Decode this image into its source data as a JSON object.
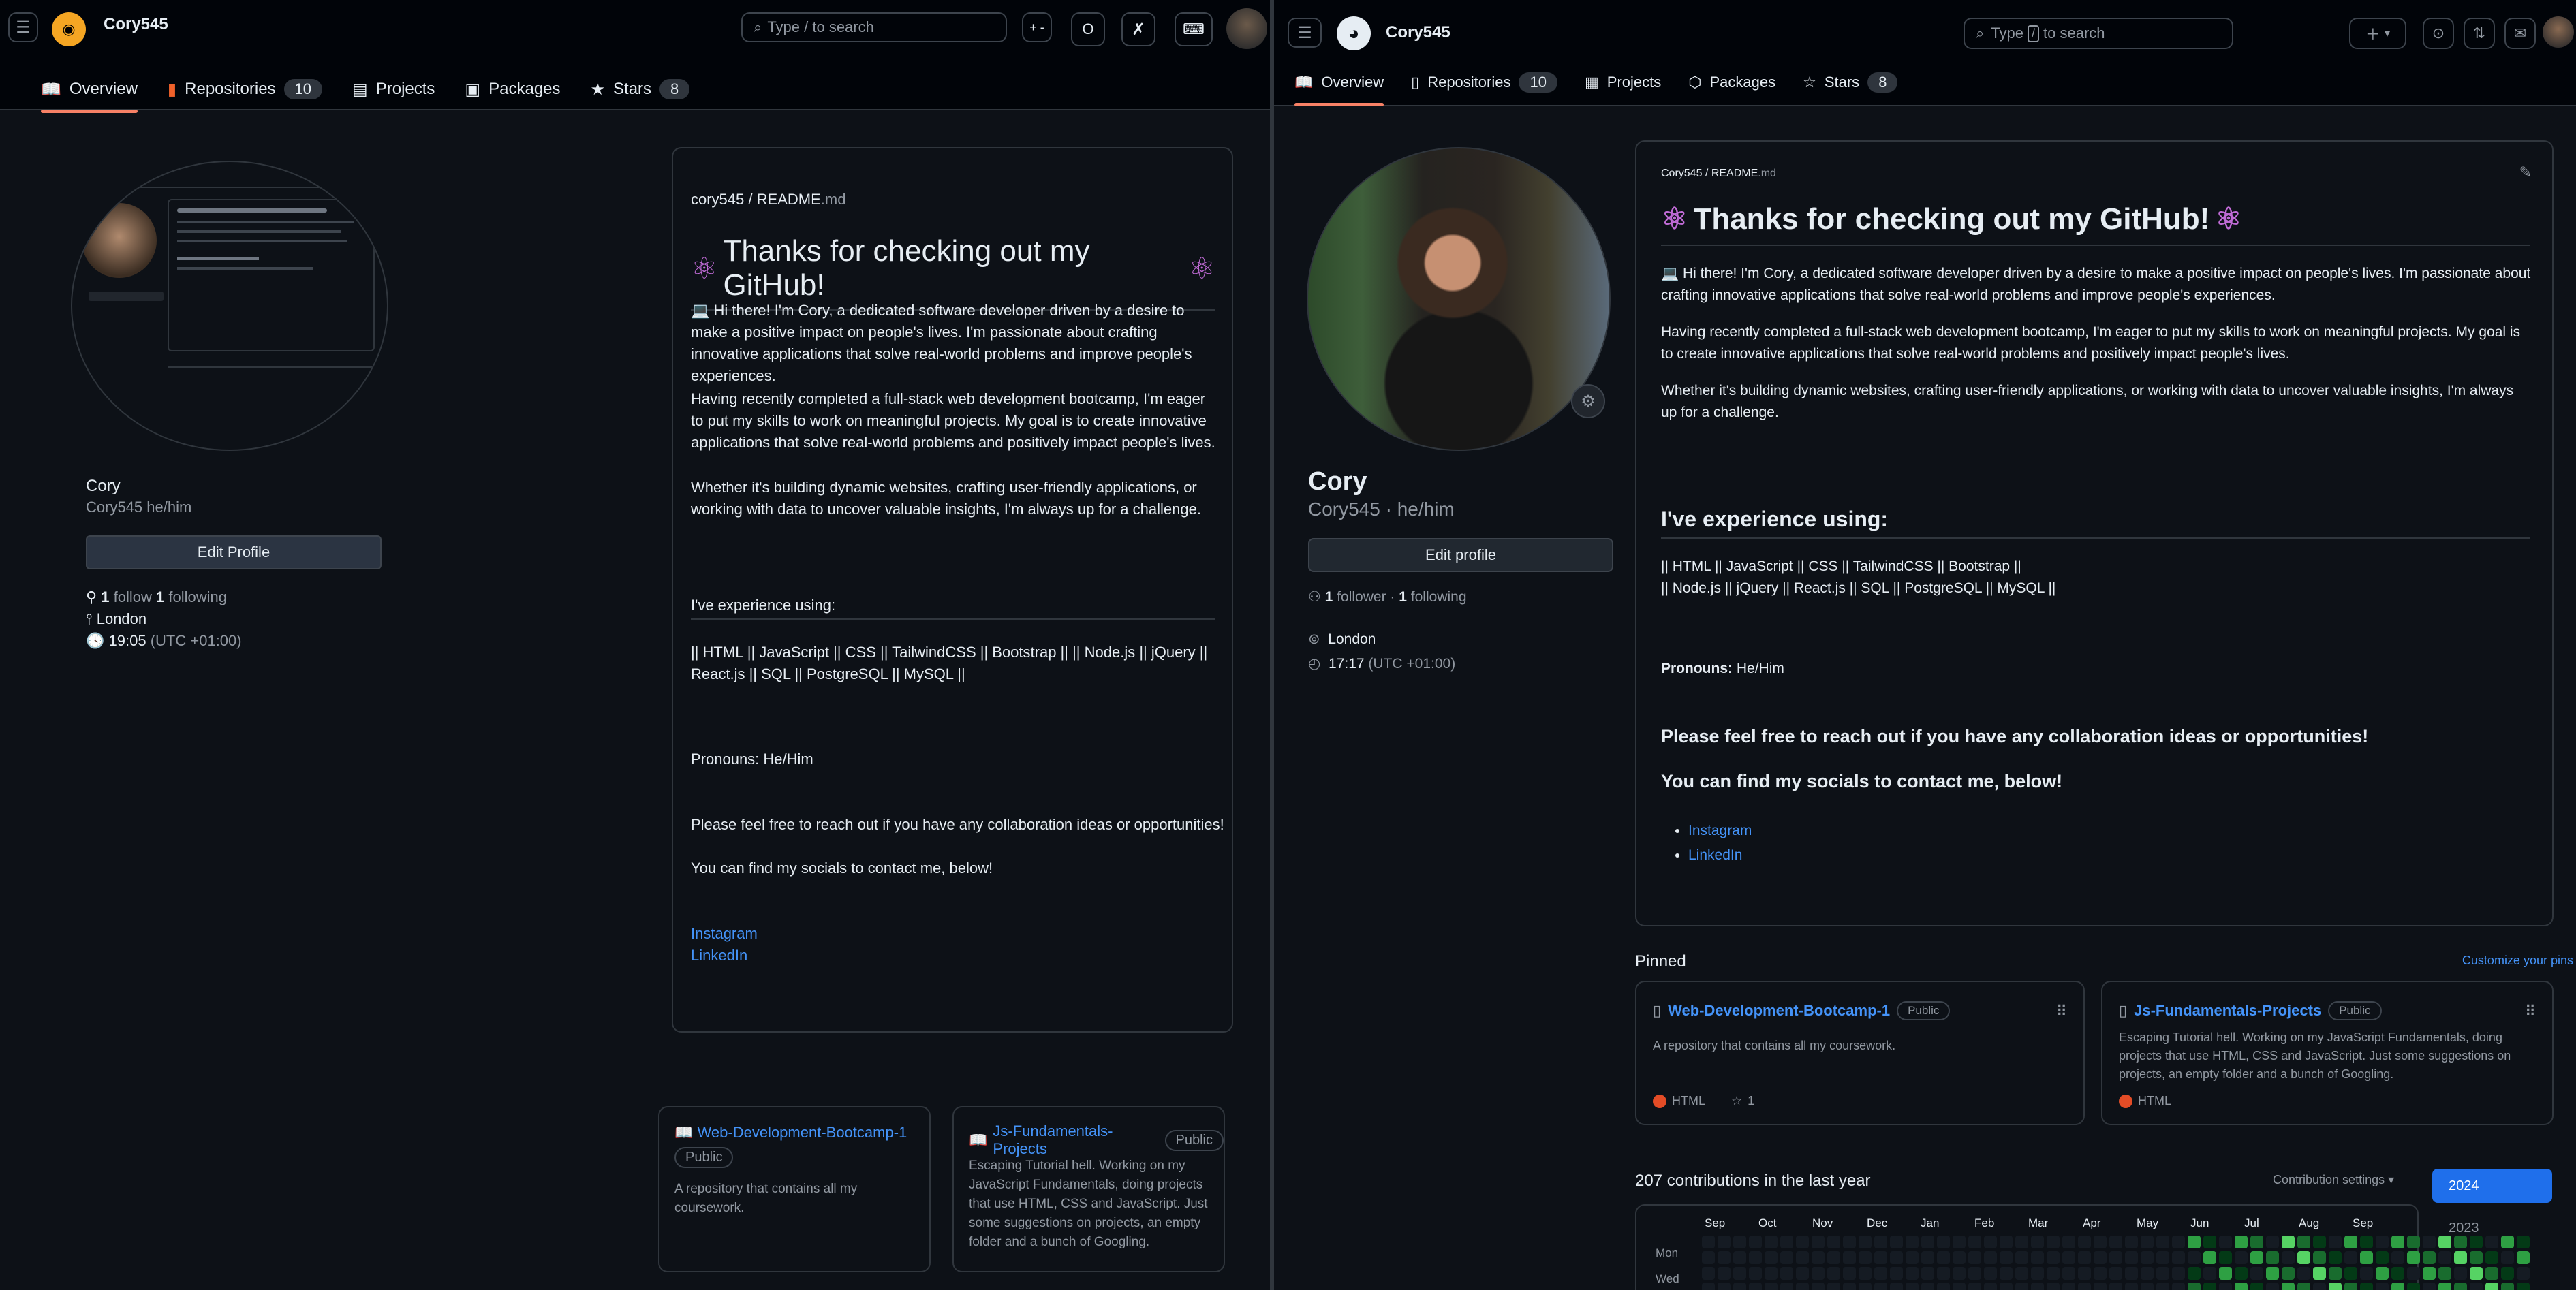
{
  "left": {
    "header": {
      "user": "Cory545",
      "search_placeholder": "Type / to search",
      "plusminus": "+ -",
      "circle_btn": "O",
      "x_btn": "✗",
      "kbd_btn": "⌨"
    },
    "tabs": [
      {
        "label": "Overview"
      },
      {
        "label": "Repositories",
        "count": "10"
      },
      {
        "label": "Projects"
      },
      {
        "label": "Packages"
      },
      {
        "label": "Stars",
        "count": "8"
      }
    ],
    "profile": {
      "name": "Cory",
      "username": "Cory545 he/him",
      "edit": "Edit Profile",
      "followers_n": "1",
      "followers_label": "follow",
      "following_n": "1",
      "following_label": "following",
      "location": "London",
      "time": "19:05",
      "tz": "(UTC +01:00)"
    },
    "readme": {
      "path_user": "cory545",
      "path_sep": "/",
      "path_file": "README",
      "path_ext": ".md",
      "title": "Thanks for checking out my GitHub!",
      "p1": "💻 Hi there! I'm Cory, a dedicated software developer driven by a desire to make a positive impact on people's lives. I'm passionate about crafting innovative applications that solve real-world problems and improve people's experiences.",
      "p2": "Having recently completed a full-stack web development bootcamp, I'm eager to put my skills to work on meaningful projects. My goal is to create innovative applications that solve real-world problems and positively impact people's lives.",
      "p3": "Whether it's building dynamic websites, crafting user-friendly applications, or working with data to uncover valuable insights, I'm always up for a challenge.",
      "exp_heading": "I've experience using:",
      "exp_line": "|| HTML || JavaScript || CSS || TailwindCSS || Bootstrap || || Node.js || jQuery || React.js || SQL || PostgreSQL || MySQL ||",
      "pronouns": "Pronouns: He/Him",
      "reach": "Please feel free to reach out if you have any collaboration ideas or opportunities!",
      "socials": "You can find my socials to contact me, below!",
      "link1": "Instagram",
      "link2": "LinkedIn"
    },
    "pinned": [
      {
        "name": "Web-Development-Bootcamp-1",
        "badge": "Public",
        "desc": "A repository that contains all my coursework."
      },
      {
        "name": "Js-Fundamentals-Projects",
        "badge": "Public",
        "desc": "Escaping Tutorial hell. Working on my JavaScript Fundamentals, doing projects that use HTML, CSS and JavaScript. Just some suggestions on projects, an empty folder and a bunch of Googling."
      }
    ]
  },
  "right": {
    "header": {
      "user": "Cory545",
      "search_placeholder_a": "Type",
      "search_key": "/",
      "search_placeholder_b": "to search"
    },
    "tabs": [
      {
        "label": "Overview"
      },
      {
        "label": "Repositories",
        "count": "10"
      },
      {
        "label": "Projects"
      },
      {
        "label": "Packages"
      },
      {
        "label": "Stars",
        "count": "8"
      }
    ],
    "profile": {
      "name": "Cory",
      "username": "Cory545 · he/him",
      "edit": "Edit profile",
      "followers_n": "1",
      "followers_label": "follower ·",
      "following_n": "1",
      "following_label": "following",
      "location": "London",
      "time": "17:17",
      "tz": "(UTC +01:00)"
    },
    "readme": {
      "path": "Cory545 / README",
      "path_ext": ".md",
      "title": "Thanks for checking out my GitHub!",
      "p1": "💻 Hi there! I'm Cory, a dedicated software developer driven by a desire to make a positive impact on people's lives. I'm passionate about crafting innovative applications that solve real-world problems and improve people's experiences.",
      "p2": "Having recently completed a full-stack web development bootcamp, I'm eager to put my skills to work on meaningful projects. My goal is to create innovative applications that solve real-world problems and positively impact people's lives.",
      "p3": "Whether it's building dynamic websites, crafting user-friendly applications, or working with data to uncover valuable insights, I'm always up for a challenge.",
      "exp_heading": "I've experience using:",
      "exp_line1": "|| HTML || JavaScript || CSS || TailwindCSS || Bootstrap ||",
      "exp_line2": "|| Node.js || jQuery || React.js || SQL || PostgreSQL || MySQL ||",
      "pronouns_label": "Pronouns:",
      "pronouns_value": "He/Him",
      "reach": "Please feel free to reach out if you have any collaboration ideas or opportunities!",
      "socials": "You can find my socials to contact me, below!",
      "link1": "Instagram",
      "link2": "LinkedIn"
    },
    "pinned_label": "Pinned",
    "customize": "Customize your pins",
    "pinned": [
      {
        "name": "Web-Development-Bootcamp-1",
        "badge": "Public",
        "desc": "A repository that contains all my coursework.",
        "lang": "HTML",
        "stars": "1"
      },
      {
        "name": "Js-Fundamentals-Projects",
        "badge": "Public",
        "desc": "Escaping Tutorial hell. Working on my JavaScript Fundamentals, doing projects that use HTML, CSS and JavaScript. Just some suggestions on projects, an empty folder and a bunch of Googling.",
        "lang": "HTML"
      }
    ],
    "contrib_title": "207 contributions in the last year",
    "contrib_settings": "Contribution settings ▾",
    "years": [
      "2024",
      "2023"
    ],
    "months": [
      "Sep",
      "Oct",
      "Nov",
      "Dec",
      "Jan",
      "Feb",
      "Mar",
      "Apr",
      "May",
      "Jun",
      "Jul",
      "Aug",
      "Sep"
    ],
    "days": [
      "Mon",
      "Wed"
    ]
  },
  "colors": {
    "accent": "#f78166",
    "link": "#4493f8",
    "primary_btn": "#1f6feb",
    "html_lang": "#e34c26",
    "contrib_levels": [
      "#151b23",
      "#033a16",
      "#196c2e",
      "#2ea043",
      "#56d364"
    ]
  }
}
